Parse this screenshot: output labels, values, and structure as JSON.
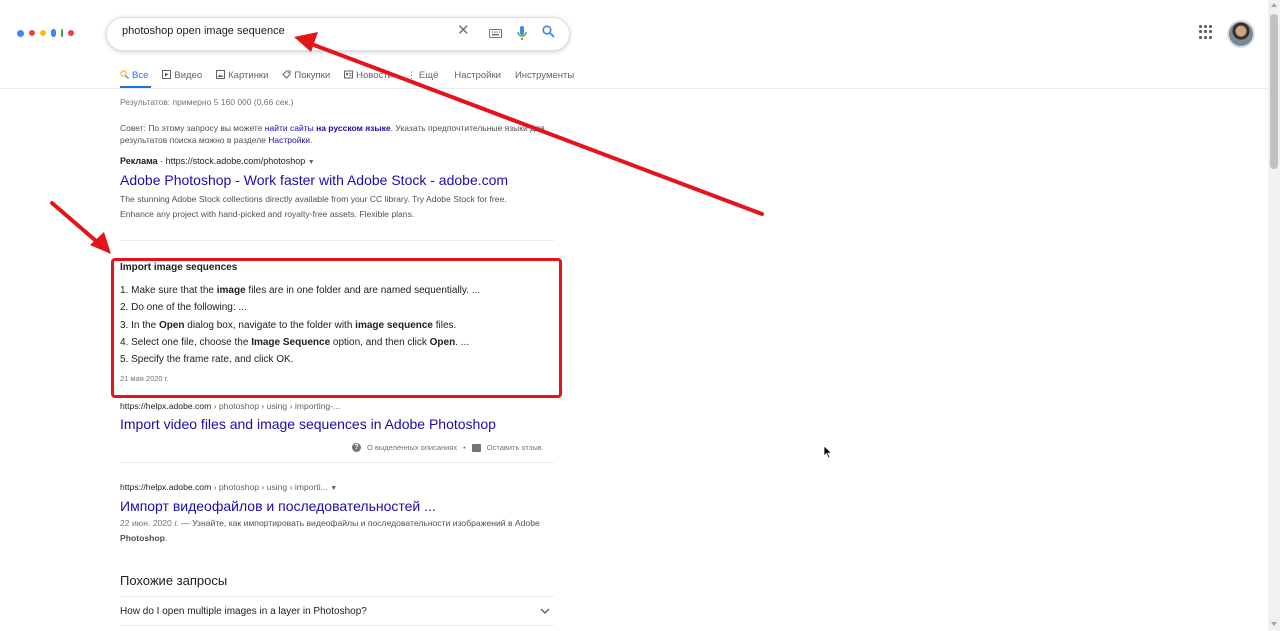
{
  "header": {
    "logo_colors": [
      "#4285f4",
      "#ea4335",
      "#fbbc05",
      "#4285f4",
      "#34a853",
      "#ea4335"
    ],
    "search_value": "photoshop open image sequence",
    "icons": [
      "close-icon",
      "keyboard-icon",
      "microphone-icon",
      "search-icon",
      "apps-icon",
      "avatar"
    ]
  },
  "tabs": [
    {
      "label": "Все",
      "icon": "search-icon"
    },
    {
      "label": "Видео",
      "icon": "video-icon"
    },
    {
      "label": "Картинки",
      "icon": "image-icon"
    },
    {
      "label": "Покупки",
      "icon": "tag-icon"
    },
    {
      "label": "Новости",
      "icon": "news-icon"
    },
    {
      "label": "Ещё",
      "icon": "more-icon"
    },
    {
      "label": "Настройки",
      "icon": ""
    },
    {
      "label": "Инструменты",
      "icon": ""
    }
  ],
  "stats": "Результатов: примерно 5 160 000 (0,66 сек.)",
  "advice": {
    "prefix": "Совет: По этому запросу вы можете ",
    "link1": "найти сайты",
    "middle": " ",
    "link2": "на русском языке",
    "suffix": ". Указать предпочтительные языки для результатов поиска можно в разделе ",
    "link3": "Настройки",
    "end": "."
  },
  "ad": {
    "label": "Реклама",
    "url": " · https://stock.adobe.com/photoshop",
    "title": "Adobe Photoshop - Work faster with Adobe Stock - adobe.com",
    "description": "The stunning Adobe Stock collections directly available from your CC library. Try Adobe Stock for free. Enhance any project with hand-picked and royalty-free assets. Flexible plans."
  },
  "snippet": {
    "title": "Import image sequences",
    "steps": [
      {
        "n": "1. ",
        "parts": [
          "Make sure that the ",
          "image",
          " files are in one folder and are named sequentially. ..."
        ]
      },
      {
        "n": "2. ",
        "parts": [
          "Do one of the following: ...",
          "",
          ""
        ]
      },
      {
        "n": "3. ",
        "parts": [
          "In the ",
          "Open",
          " dialog box, navigate to the folder with "
        ],
        "bold2": "image sequence",
        "tail": " files."
      },
      {
        "n": "4. ",
        "parts": [
          "Select one file, choose the ",
          "Image Sequence",
          " option, and then click "
        ],
        "bold2": "Open",
        "tail": ". ..."
      },
      {
        "n": "5. ",
        "parts": [
          "Specify the frame rate, and click OK.",
          "",
          ""
        ]
      }
    ],
    "date": "21 мая 2020 г."
  },
  "result1": {
    "domain": "https://helpx.adobe.com",
    "path": " › photoshop › using › importing-...",
    "title": "Import video files and image sequences in Adobe Photoshop",
    "feedback1": "О выделенных описаниях",
    "feedback2": "Оставить отзыв"
  },
  "result2": {
    "domain": "https://helpx.adobe.com",
    "path": " › photoshop › using › importi...",
    "title": "Импорт видеофайлов и последовательностей ...",
    "date": "22 июн. 2020 г.",
    "desc": " — Узнайте, как импортировать видеофайлы и последовательности изображений в Adobe ",
    "desc_bold": "Photoshop",
    "desc_end": "."
  },
  "related": {
    "heading": "Похожие запросы",
    "items": [
      "How do I open multiple images in a layer in Photoshop?"
    ]
  },
  "annotation_color": "#e3151a"
}
